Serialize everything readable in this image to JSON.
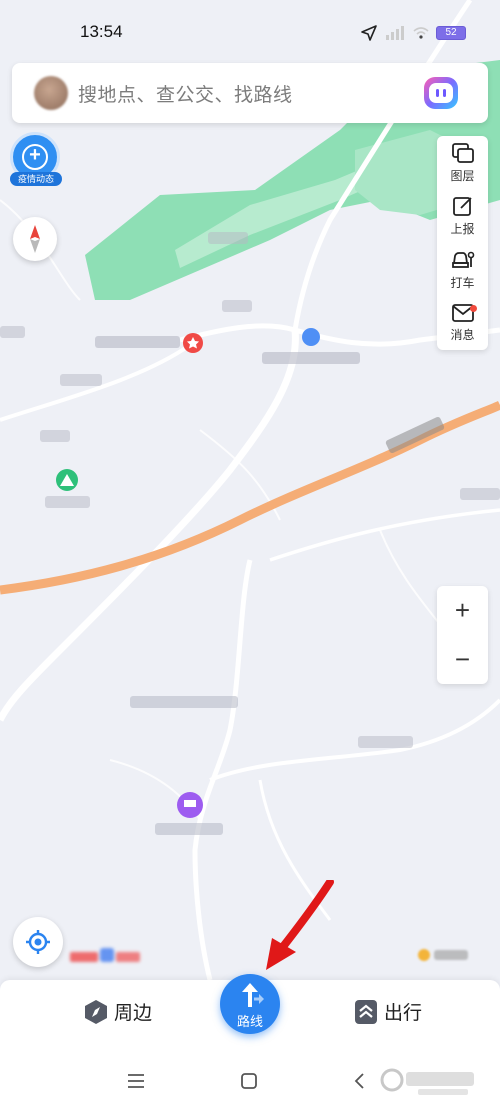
{
  "status_bar": {
    "time": "13:54",
    "battery": "52"
  },
  "search": {
    "placeholder": "搜地点、查公交、找路线"
  },
  "epidemic": {
    "label": "疫情动态"
  },
  "right_tools": [
    {
      "label": "图层",
      "icon": "layers-icon"
    },
    {
      "label": "上报",
      "icon": "report-icon"
    },
    {
      "label": "打车",
      "icon": "taxi-icon"
    },
    {
      "label": "消息",
      "icon": "message-icon",
      "has_dot": true
    }
  ],
  "zoom": {
    "in": "+",
    "out": "−"
  },
  "bottom": {
    "nearby": "周边",
    "route": "路线",
    "travel": "出行"
  },
  "colors": {
    "primary": "#2b84f0",
    "highway": "#f6b07a",
    "green_area": "#74d8a8",
    "annotation_arrow": "#e01818"
  }
}
